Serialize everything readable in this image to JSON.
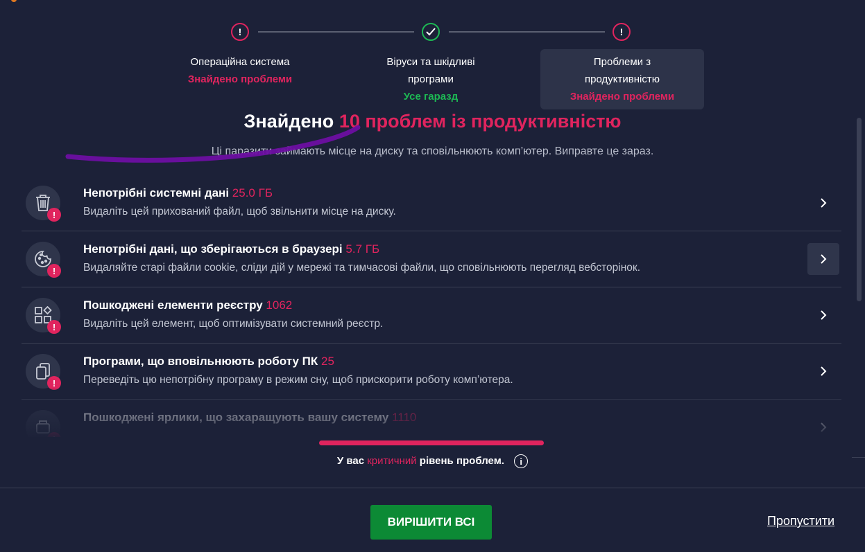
{
  "colors": {
    "background": "#1c2138",
    "danger": "#e0245e",
    "success": "#1db954",
    "primary_button": "#0c8a35"
  },
  "steps": [
    {
      "icon": "exclamation-icon",
      "state": "error",
      "title_lines": [
        "Операційна система"
      ],
      "status": "Знайдено проблеми"
    },
    {
      "icon": "check-icon",
      "state": "ok",
      "title_lines": [
        "Віруси та шкідливі",
        "програми"
      ],
      "status": "Усе гаразд"
    },
    {
      "icon": "exclamation-icon",
      "state": "error",
      "title_lines": [
        "Проблеми з",
        "продуктивністю"
      ],
      "status": "Знайдено проблеми",
      "active": true
    }
  ],
  "heading": {
    "prefix": "Знайдено",
    "count": "10",
    "suffix": "проблем із продуктивністю"
  },
  "subheading": "Ці паразити займають місце на диску та сповільнюють комп’ютер. Виправте це зараз.",
  "issues": [
    {
      "icon": "trash-icon",
      "title": "Непотрібні системні дані",
      "value": "25.0 ГБ",
      "description": "Видаліть цей прихований файл, щоб звільнити місце на диску."
    },
    {
      "icon": "cookie-icon",
      "title": "Непотрібні дані, що зберігаються в браузері",
      "value": "5.7 ГБ",
      "description": "Видаляйте старі файли cookie, сліди дій у мережі та тимчасові файли, що сповільнюють перегляд вебсторінок."
    },
    {
      "icon": "registry-icon",
      "title": "Пошкоджені елементи реєстру",
      "value": "1062",
      "description": "Видаліть цей елемент, щоб оптимізувати системний реєстр."
    },
    {
      "icon": "apps-icon",
      "title": "Програми, що вповільнюють роботу ПК",
      "value": "25",
      "description": "Переведіть цю непотрібну програму в режим сну, щоб прискорити роботу комп’ютера."
    },
    {
      "icon": "shortcut-icon",
      "title": "Пошкоджені ярлики, що захаращують вашу систему",
      "value": "1110",
      "description": ""
    }
  ],
  "severity": {
    "prefix": "У вас",
    "level": "критичний",
    "suffix": "рівень проблем."
  },
  "buttons": {
    "fix_all": "ВИРІШИТИ ВСІ",
    "skip": "Пропустити"
  }
}
